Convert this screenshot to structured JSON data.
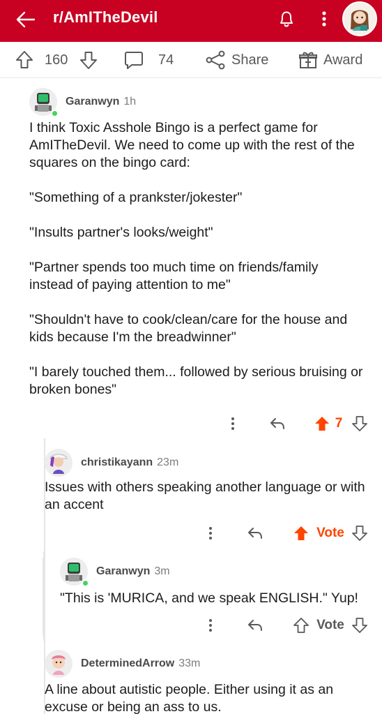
{
  "header": {
    "title": "r/AmITheDevil",
    "back_icon": "arrow-left-icon",
    "bell_icon": "bell-icon",
    "menu_icon": "more-vertical-icon",
    "bg_color": "#c80021"
  },
  "post_bar": {
    "upvotes": "160",
    "comments": "74",
    "share_label": "Share",
    "award_label": "Award"
  },
  "comments": [
    {
      "author": "Garanwyn",
      "time": "1h",
      "paragraphs": [
        "I think Toxic Asshole Bingo is a perfect game for AmITheDevil.  We need to come up with the rest of the squares on the bingo card:",
        "\"Something of a prankster/jokester\"",
        "\"Insults partner's looks/weight\"",
        "\"Partner spends too much time on friends/family instead of paying attention to me\"",
        "\"Shouldn't have to cook/clean/care for the house and kids because I'm the breadwinner\"",
        "\"I barely touched them... followed by serious bruising or broken bones\""
      ],
      "vote": "7"
    },
    {
      "author": "christikayann",
      "time": "23m",
      "paragraphs": [
        "Issues with others speaking another language or with an accent"
      ],
      "vote": "Vote"
    },
    {
      "author": "Garanwyn",
      "time": "3m",
      "paragraphs": [
        "\"This is 'MURICA, and we speak ENGLISH.\"  Yup!"
      ],
      "vote": "Vote"
    },
    {
      "author": "DeterminedArrow",
      "time": "33m",
      "paragraphs": [
        "A line about autistic people. Either using it as an excuse or being an ass to us."
      ]
    }
  ],
  "colors": {
    "accent": "#ff4500",
    "online": "#46d160"
  }
}
